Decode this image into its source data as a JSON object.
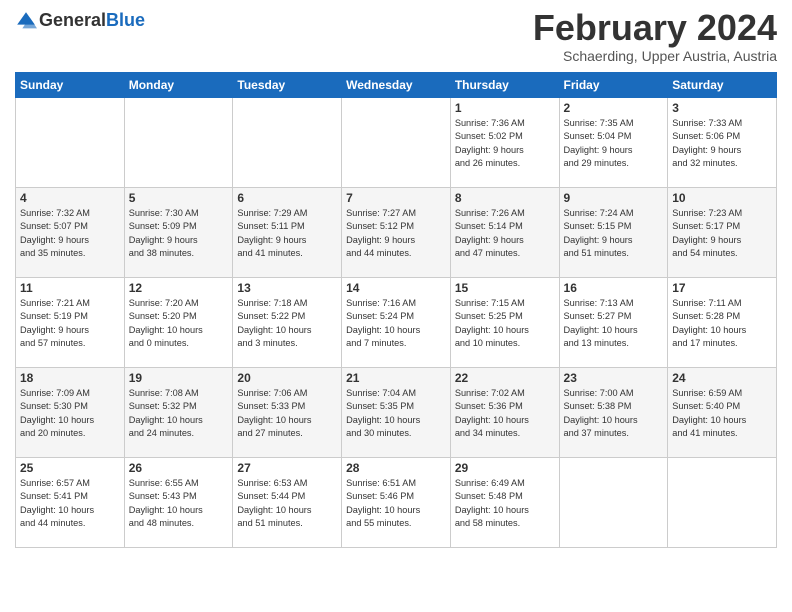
{
  "header": {
    "logo_general": "General",
    "logo_blue": "Blue",
    "month_title": "February 2024",
    "location": "Schaerding, Upper Austria, Austria"
  },
  "weekdays": [
    "Sunday",
    "Monday",
    "Tuesday",
    "Wednesday",
    "Thursday",
    "Friday",
    "Saturday"
  ],
  "weeks": [
    [
      {
        "day": "",
        "info": ""
      },
      {
        "day": "",
        "info": ""
      },
      {
        "day": "",
        "info": ""
      },
      {
        "day": "",
        "info": ""
      },
      {
        "day": "1",
        "info": "Sunrise: 7:36 AM\nSunset: 5:02 PM\nDaylight: 9 hours\nand 26 minutes."
      },
      {
        "day": "2",
        "info": "Sunrise: 7:35 AM\nSunset: 5:04 PM\nDaylight: 9 hours\nand 29 minutes."
      },
      {
        "day": "3",
        "info": "Sunrise: 7:33 AM\nSunset: 5:06 PM\nDaylight: 9 hours\nand 32 minutes."
      }
    ],
    [
      {
        "day": "4",
        "info": "Sunrise: 7:32 AM\nSunset: 5:07 PM\nDaylight: 9 hours\nand 35 minutes."
      },
      {
        "day": "5",
        "info": "Sunrise: 7:30 AM\nSunset: 5:09 PM\nDaylight: 9 hours\nand 38 minutes."
      },
      {
        "day": "6",
        "info": "Sunrise: 7:29 AM\nSunset: 5:11 PM\nDaylight: 9 hours\nand 41 minutes."
      },
      {
        "day": "7",
        "info": "Sunrise: 7:27 AM\nSunset: 5:12 PM\nDaylight: 9 hours\nand 44 minutes."
      },
      {
        "day": "8",
        "info": "Sunrise: 7:26 AM\nSunset: 5:14 PM\nDaylight: 9 hours\nand 47 minutes."
      },
      {
        "day": "9",
        "info": "Sunrise: 7:24 AM\nSunset: 5:15 PM\nDaylight: 9 hours\nand 51 minutes."
      },
      {
        "day": "10",
        "info": "Sunrise: 7:23 AM\nSunset: 5:17 PM\nDaylight: 9 hours\nand 54 minutes."
      }
    ],
    [
      {
        "day": "11",
        "info": "Sunrise: 7:21 AM\nSunset: 5:19 PM\nDaylight: 9 hours\nand 57 minutes."
      },
      {
        "day": "12",
        "info": "Sunrise: 7:20 AM\nSunset: 5:20 PM\nDaylight: 10 hours\nand 0 minutes."
      },
      {
        "day": "13",
        "info": "Sunrise: 7:18 AM\nSunset: 5:22 PM\nDaylight: 10 hours\nand 3 minutes."
      },
      {
        "day": "14",
        "info": "Sunrise: 7:16 AM\nSunset: 5:24 PM\nDaylight: 10 hours\nand 7 minutes."
      },
      {
        "day": "15",
        "info": "Sunrise: 7:15 AM\nSunset: 5:25 PM\nDaylight: 10 hours\nand 10 minutes."
      },
      {
        "day": "16",
        "info": "Sunrise: 7:13 AM\nSunset: 5:27 PM\nDaylight: 10 hours\nand 13 minutes."
      },
      {
        "day": "17",
        "info": "Sunrise: 7:11 AM\nSunset: 5:28 PM\nDaylight: 10 hours\nand 17 minutes."
      }
    ],
    [
      {
        "day": "18",
        "info": "Sunrise: 7:09 AM\nSunset: 5:30 PM\nDaylight: 10 hours\nand 20 minutes."
      },
      {
        "day": "19",
        "info": "Sunrise: 7:08 AM\nSunset: 5:32 PM\nDaylight: 10 hours\nand 24 minutes."
      },
      {
        "day": "20",
        "info": "Sunrise: 7:06 AM\nSunset: 5:33 PM\nDaylight: 10 hours\nand 27 minutes."
      },
      {
        "day": "21",
        "info": "Sunrise: 7:04 AM\nSunset: 5:35 PM\nDaylight: 10 hours\nand 30 minutes."
      },
      {
        "day": "22",
        "info": "Sunrise: 7:02 AM\nSunset: 5:36 PM\nDaylight: 10 hours\nand 34 minutes."
      },
      {
        "day": "23",
        "info": "Sunrise: 7:00 AM\nSunset: 5:38 PM\nDaylight: 10 hours\nand 37 minutes."
      },
      {
        "day": "24",
        "info": "Sunrise: 6:59 AM\nSunset: 5:40 PM\nDaylight: 10 hours\nand 41 minutes."
      }
    ],
    [
      {
        "day": "25",
        "info": "Sunrise: 6:57 AM\nSunset: 5:41 PM\nDaylight: 10 hours\nand 44 minutes."
      },
      {
        "day": "26",
        "info": "Sunrise: 6:55 AM\nSunset: 5:43 PM\nDaylight: 10 hours\nand 48 minutes."
      },
      {
        "day": "27",
        "info": "Sunrise: 6:53 AM\nSunset: 5:44 PM\nDaylight: 10 hours\nand 51 minutes."
      },
      {
        "day": "28",
        "info": "Sunrise: 6:51 AM\nSunset: 5:46 PM\nDaylight: 10 hours\nand 55 minutes."
      },
      {
        "day": "29",
        "info": "Sunrise: 6:49 AM\nSunset: 5:48 PM\nDaylight: 10 hours\nand 58 minutes."
      },
      {
        "day": "",
        "info": ""
      },
      {
        "day": "",
        "info": ""
      }
    ]
  ]
}
